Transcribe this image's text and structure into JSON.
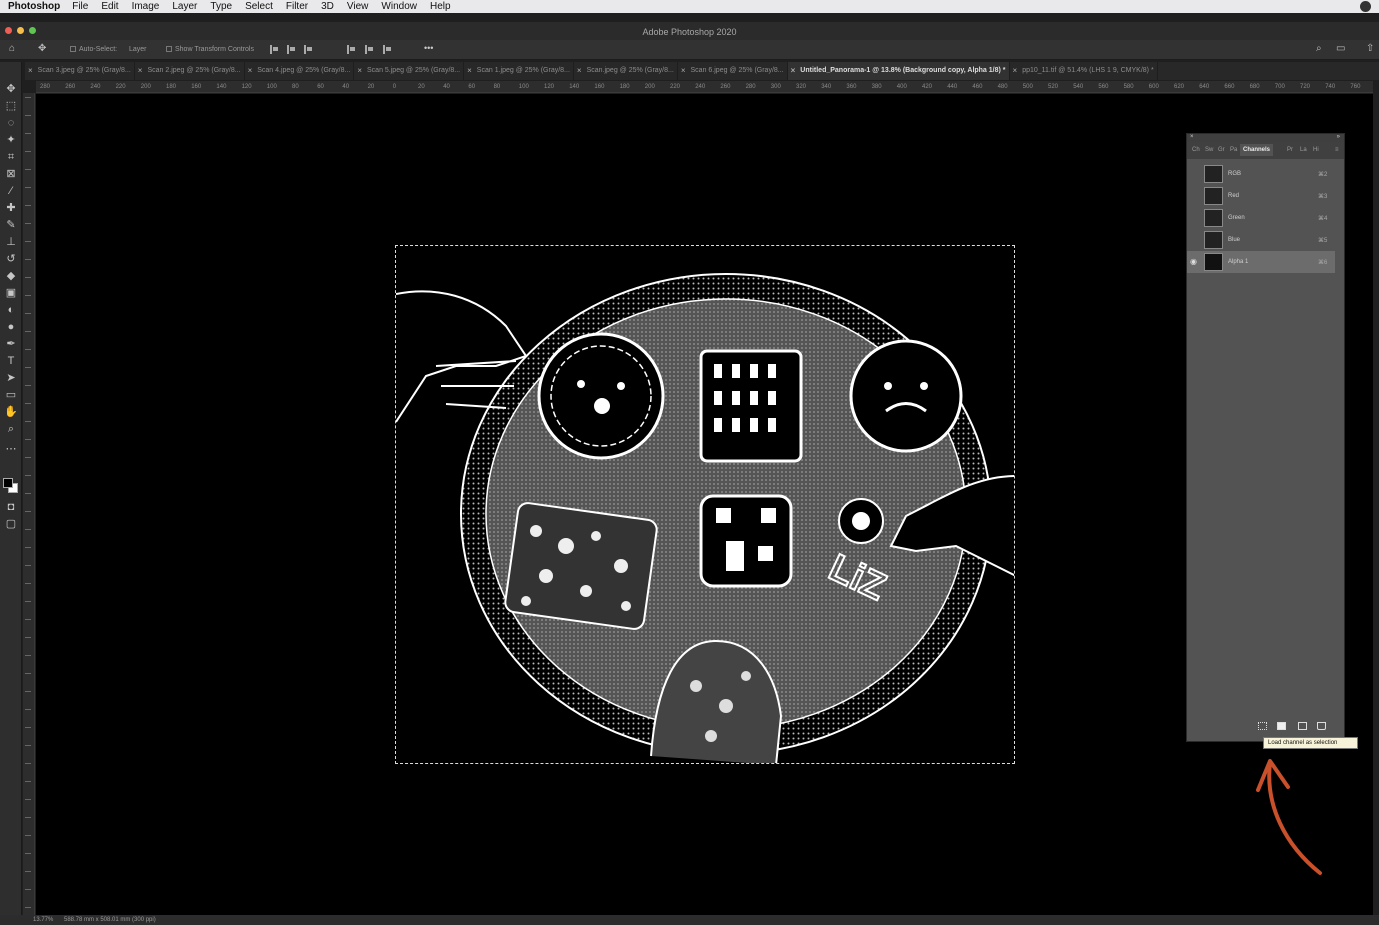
{
  "menubar": {
    "app": "Photoshop",
    "items": [
      "File",
      "Edit",
      "Image",
      "Layer",
      "Type",
      "Select",
      "Filter",
      "3D",
      "View",
      "Window",
      "Help"
    ]
  },
  "window": {
    "title": "Adobe Photoshop 2020"
  },
  "options": {
    "auto_select": "Auto-Select:",
    "layer_select": "Layer",
    "show_transform": "Show Transform Controls",
    "more": "•••"
  },
  "tabs": [
    {
      "label": "Scan 3.jpeg @ 25% (Gray/8..."
    },
    {
      "label": "Scan 2.jpeg @ 25% (Gray/8..."
    },
    {
      "label": "Scan 4.jpeg @ 25% (Gray/8..."
    },
    {
      "label": "Scan 5.jpeg @ 25% (Gray/8..."
    },
    {
      "label": "Scan 1.jpeg @ 25% (Gray/8..."
    },
    {
      "label": "Scan.jpeg @ 25% (Gray/8..."
    },
    {
      "label": "Scan 6.jpeg @ 25% (Gray/8..."
    },
    {
      "label": "Untitled_Panorama-1 @ 13.8% (Background copy, Alpha 1/8) *"
    },
    {
      "label": "pp10_11.tif @ 51.4% (LHS 1 9, CMYK/8) *"
    }
  ],
  "ruler": {
    "h_labels": [
      "280",
      "260",
      "240",
      "220",
      "200",
      "180",
      "160",
      "140",
      "120",
      "100",
      "80",
      "60",
      "40",
      "20",
      "0",
      "20",
      "40",
      "60",
      "80",
      "100",
      "120",
      "140",
      "160",
      "180",
      "200",
      "220",
      "240",
      "260",
      "280",
      "300",
      "320",
      "340",
      "360",
      "380",
      "400",
      "420",
      "440",
      "460",
      "480",
      "500",
      "520",
      "540",
      "560",
      "580",
      "600",
      "620",
      "640",
      "660",
      "680",
      "700",
      "720",
      "740",
      "760"
    ]
  },
  "channels_panel": {
    "tabs": [
      "Ch",
      "Sw",
      "Gr",
      "Pa",
      "Channels",
      "Pr",
      "La",
      "Hi"
    ],
    "active_tab": "Channels",
    "rows": [
      {
        "name": "RGB",
        "shortcut": "⌘2",
        "visible": false,
        "selected": false
      },
      {
        "name": "Red",
        "shortcut": "⌘3",
        "visible": false,
        "selected": false
      },
      {
        "name": "Green",
        "shortcut": "⌘4",
        "visible": false,
        "selected": false
      },
      {
        "name": "Blue",
        "shortcut": "⌘5",
        "visible": false,
        "selected": false
      },
      {
        "name": "Alpha 1",
        "shortcut": "⌘6",
        "visible": true,
        "selected": true
      }
    ],
    "tooltip": "Load channel as selection"
  },
  "status": {
    "zoom": "13.77%",
    "doc_info": "588.78 mm x 508.01 mm (300 ppi)"
  },
  "colors": {
    "annotation_arrow": "#c8502a",
    "canvas_bg": "#000000",
    "panel_bg": "#535353"
  }
}
